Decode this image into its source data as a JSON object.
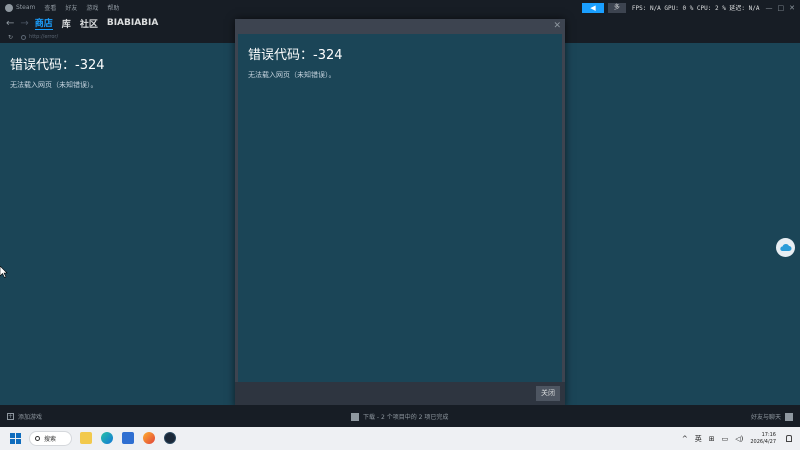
{
  "menubar": {
    "app_name": "Steam",
    "items": [
      "查看",
      "好友",
      "游戏",
      "帮助"
    ],
    "friends_button": "多",
    "perf_overlay": "FPS: N/A  GPU: 0 %  CPU: 2 %  延迟: N/A",
    "window_controls": [
      "—",
      "□",
      "✕"
    ]
  },
  "navbar": {
    "tabs": [
      "商店",
      "库",
      "社区",
      "BIABIABIA"
    ],
    "active_tab": "商店",
    "url": "http://error/"
  },
  "page": {
    "error_title": "错误代码：-324",
    "error_message": "无法载入网页（未知错误）。"
  },
  "dialog": {
    "error_title": "错误代码：-324",
    "error_message": "无法载入网页（未知错误）。",
    "close_button": "关闭"
  },
  "bottombar": {
    "add_game": "添加游戏",
    "download_status": "下载 - 2 个项目中的 2 项已完成",
    "friends_chat": "好友与聊天"
  },
  "taskbar": {
    "search_label": "搜索",
    "apps": [
      "file-explorer-icon",
      "edge-icon",
      "store-icon",
      "firefox-icon",
      "steam-icon"
    ],
    "tray": {
      "ime_lang": "英",
      "time": "17:16",
      "date": "2026/4/27"
    }
  },
  "colors": {
    "accent": "#1a9fff",
    "page_bg": "#1b4557",
    "chrome_bg": "#171d25"
  }
}
